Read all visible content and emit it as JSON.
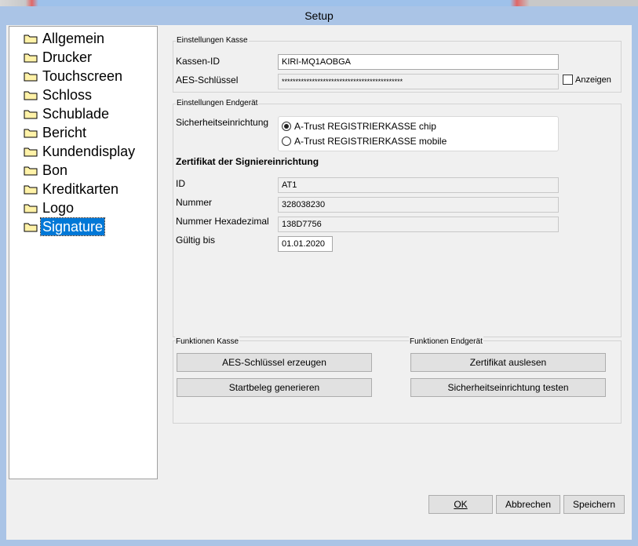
{
  "window": {
    "title": "Setup"
  },
  "tree": {
    "items": [
      {
        "label": "Allgemein"
      },
      {
        "label": "Drucker"
      },
      {
        "label": "Touchscreen"
      },
      {
        "label": "Schloss"
      },
      {
        "label": "Schublade"
      },
      {
        "label": "Bericht"
      },
      {
        "label": "Kundendisplay"
      },
      {
        "label": "Bon"
      },
      {
        "label": "Kreditkarten"
      },
      {
        "label": "Logo"
      },
      {
        "label": "Signature"
      }
    ],
    "selected": "Signature"
  },
  "kasse": {
    "group_title": "Einstellungen Kasse",
    "kassen_id_label": "Kassen-ID",
    "kassen_id_value": "KIRI-MQ1AOBGA",
    "aes_label": "AES-Schlüssel",
    "aes_value": "********************************************",
    "show_label": "Anzeigen"
  },
  "endgeraet": {
    "group_title": "Einstellungen Endgerät",
    "sicherheit_label": "Sicherheitseinrichtung",
    "options": [
      "A-Trust REGISTRIERKASSE chip",
      "A-Trust REGISTRIERKASSE mobile"
    ],
    "selected_option": "A-Trust REGISTRIERKASSE chip",
    "zert_heading": "Zertifikat der Signiereinrichtung",
    "id_label": "ID",
    "id_value": "AT1",
    "nummer_label": "Nummer",
    "nummer_value": "328038230",
    "hex_label": "Nummer Hexadezimal",
    "hex_value": "138D7756",
    "gueltig_label": "Gültig bis",
    "gueltig_value": "01.01.2020"
  },
  "funktionen": {
    "kasse_title": "Funktionen Kasse",
    "endgeraet_title": "Funktionen Endgerät",
    "aes_button": "AES-Schlüssel erzeugen",
    "startbeleg_button": "Startbeleg generieren",
    "zertifikat_button": "Zertifikat auslesen",
    "testen_button": "Sicherheitseinrichtung testen"
  },
  "footer": {
    "ok": "OK",
    "abbrechen": "Abbrechen",
    "speichern": "Speichern"
  }
}
